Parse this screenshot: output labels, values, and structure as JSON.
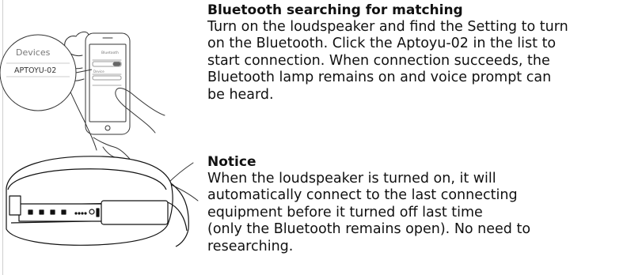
{
  "illustration": {
    "callout_heading": "Devices",
    "callout_device": "APTOYU-02",
    "phone_heading": "Bluetooth",
    "phone_device_label": "Device",
    "icons": [
      "hand-with-phone-icon",
      "speaker-icon"
    ]
  },
  "sections": {
    "bluetooth": {
      "title": "Bluetooth searching for matching",
      "lines": [
        "Turn on the loudspeaker and find the Setting to turn",
        "on the Bluetooth. Click the Aptoyu-02 in the list to",
        "start connection. When connection succeeds, the",
        "Bluetooth lamp remains on and voice prompt can",
        "be heard."
      ]
    },
    "notice": {
      "title": "Notice",
      "lines": [
        "When the loudspeaker is turned on, it will",
        "automatically connect to the last connecting",
        "equipment before it turned off last time",
        "(only the Bluetooth remains open). No need to",
        "researching."
      ]
    }
  }
}
